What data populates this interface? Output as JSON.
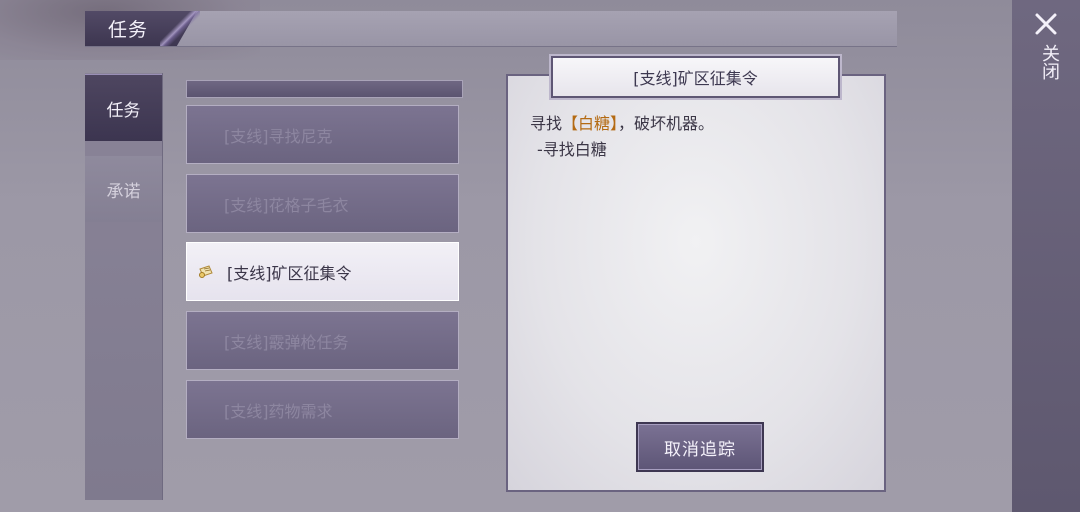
{
  "header": {
    "title": "任务"
  },
  "sidebar": {
    "tabs": [
      {
        "label": "任务",
        "active": true
      },
      {
        "label": "承诺",
        "active": false
      }
    ]
  },
  "quests": {
    "items": [
      {
        "label": "[支线]寻找尼克",
        "selected": false
      },
      {
        "label": "[支线]花格子毛衣",
        "selected": false
      },
      {
        "label": "[支线]矿区征集令",
        "selected": true,
        "icon": "scroll-icon"
      },
      {
        "label": "[支线]霰弹枪任务",
        "selected": false
      },
      {
        "label": "[支线]药物需求",
        "selected": false
      }
    ]
  },
  "detail": {
    "title": "[支线]矿区征集令",
    "desc_prefix": "寻找",
    "desc_highlight": "【白糖】",
    "desc_suffix": "，破坏机器。",
    "step": "-寻找白糖",
    "cancel_label": "取消追踪"
  },
  "close": {
    "label": "关闭",
    "icon": "close-icon"
  },
  "colors": {
    "highlight": "#b46a12",
    "accent": "#4e4660"
  }
}
